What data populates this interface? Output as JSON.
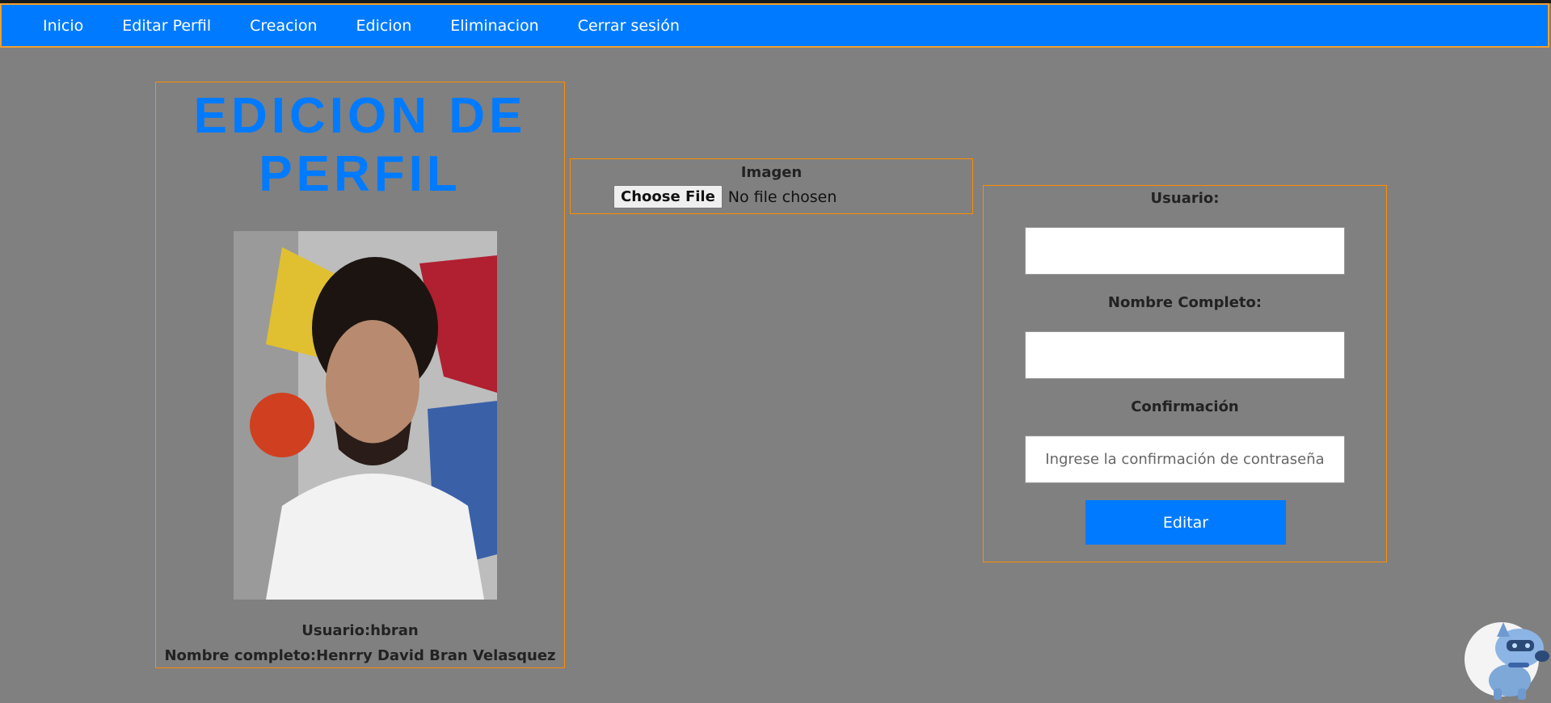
{
  "nav": {
    "items": [
      {
        "label": "Inicio"
      },
      {
        "label": "Editar Perfil"
      },
      {
        "label": "Creacion"
      },
      {
        "label": "Edicion"
      },
      {
        "label": "Eliminacion"
      },
      {
        "label": "Cerrar sesión"
      }
    ]
  },
  "profile": {
    "title_line1": "EDICION DE",
    "title_line2": "PERFIL",
    "user_label": "Usuario:hbran",
    "name_label": "Nombre completo:Henrry David Bran Velasquez"
  },
  "image_upload": {
    "label": "Imagen",
    "button_label": "Choose File",
    "status": "No file chosen"
  },
  "form": {
    "usuario_label": "Usuario:",
    "usuario_value": "",
    "nombre_label": "Nombre Completo:",
    "nombre_value": "",
    "confirm_label": "Confirmación",
    "confirm_placeholder": "Ingrese la confirmación de contraseña",
    "submit_label": "Editar"
  },
  "colors": {
    "nav_bg": "#007bff",
    "accent": "#007bff",
    "panel_border": "#ff8c00",
    "page_bg": "#808080"
  }
}
